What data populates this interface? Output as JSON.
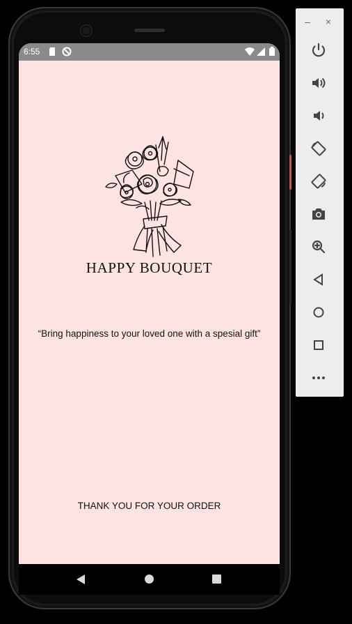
{
  "status": {
    "time": "6:55"
  },
  "app": {
    "brand": "HAPPY BOUQUET",
    "tagline": "“Bring happiness to your loved one with a spesial gift”",
    "thanks": "THANK YOU FOR YOUR ORDER"
  },
  "emulator": {
    "window_controls": {
      "minimize": "–",
      "close": "×"
    }
  },
  "colors": {
    "screen_bg": "#fde4e3",
    "status_bar": "#8a8a8a",
    "emulator_panel": "#ededed"
  }
}
